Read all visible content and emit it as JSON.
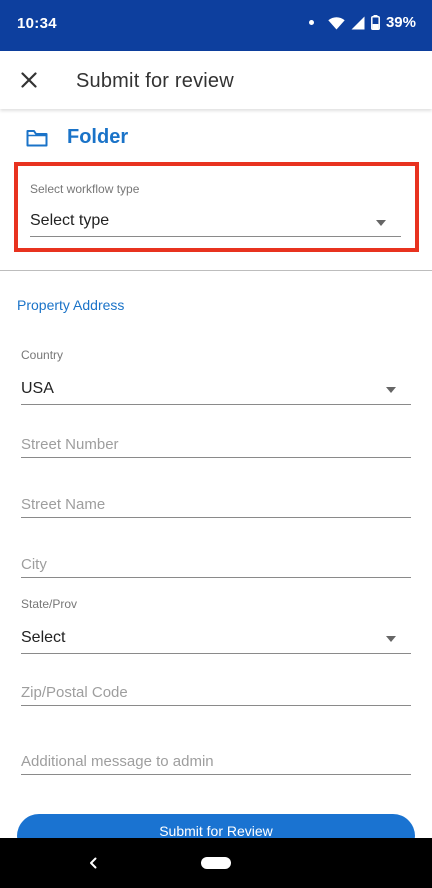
{
  "status_bar": {
    "time": "10:34",
    "battery": "39%",
    "icons": [
      "notification-dot-icon",
      "wifi-icon",
      "signal-icon",
      "battery-icon"
    ]
  },
  "app_bar": {
    "close_icon": "close-icon",
    "title": "Submit for review"
  },
  "folder": {
    "icon": "folder-icon",
    "label": "Folder"
  },
  "workflow": {
    "label": "Select workflow type",
    "value": "Select type"
  },
  "property_address": {
    "section_title": "Property Address",
    "country": {
      "label": "Country",
      "value": "USA"
    },
    "street_number": {
      "placeholder": "Street Number",
      "value": ""
    },
    "street_name": {
      "placeholder": "Street Name",
      "value": ""
    },
    "city": {
      "placeholder": "City",
      "value": ""
    },
    "state": {
      "label": "State/Prov",
      "value": "Select"
    },
    "zip": {
      "placeholder": "Zip/Postal Code",
      "value": ""
    },
    "message": {
      "placeholder": "Additional message to admin",
      "value": ""
    }
  },
  "submit": {
    "label": "Submit for Review"
  },
  "colors": {
    "status_bar": "#0d3f9e",
    "accent": "#1a73c8",
    "button": "#1a73d1",
    "highlight": "#e8321f"
  }
}
